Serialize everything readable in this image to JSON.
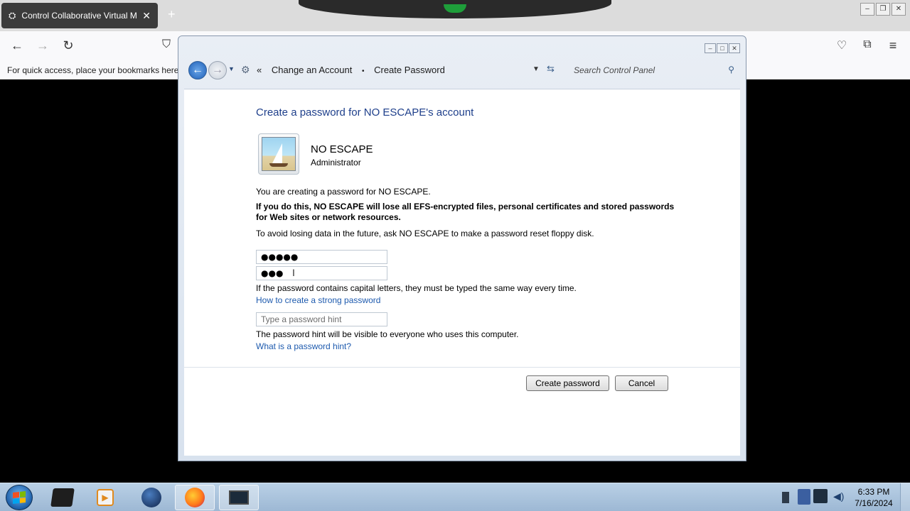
{
  "browser": {
    "tab_title": "Control Collaborative Virtual M",
    "tab_close": "✕",
    "new_tab": "+",
    "bookmarks_hint": "For quick access, place your bookmarks here on",
    "nav": {
      "back": "←",
      "forward": "→",
      "reload": "↻",
      "shield": "⛉",
      "pocket": "♡",
      "extensions": "⧉",
      "menu": "≡"
    },
    "window_controls": [
      "–",
      "❐",
      "✕"
    ]
  },
  "window": {
    "caption_buttons": [
      "–",
      "□",
      "✕"
    ],
    "breadcrumb": {
      "prefix": "«",
      "items": [
        "Change an Account",
        "Create Password"
      ],
      "separator": "•"
    },
    "search_placeholder": "Search Control Panel"
  },
  "content": {
    "heading": "Create a password for NO ESCAPE's account",
    "user": {
      "name": "NO ESCAPE",
      "type": "Administrator"
    },
    "info_text": "You are creating a password for NO ESCAPE.",
    "warning_text": "If you do this, NO ESCAPE will lose all EFS-encrypted files, personal certificates and stored passwords for Web sites or network resources.",
    "advice_text": "To avoid losing data in the future, ask NO ESCAPE to make a password reset floppy disk.",
    "password_value": "●●●●●",
    "confirm_value": "●●●",
    "caps_note": "If the password contains capital letters, they must be typed the same way every time.",
    "strong_link": "How to create a strong password",
    "hint_placeholder": "Type a password hint",
    "hint_note": "The password hint will be visible to everyone who uses this computer.",
    "hint_link": "What is a password hint?",
    "create_button": "Create password",
    "cancel_button": "Cancel"
  },
  "taskbar": {
    "apps": [
      "terminal",
      "media-player",
      "browser-globe",
      "firefox",
      "remote-desktop"
    ],
    "clock_time": "6:33 PM",
    "clock_date": "7/16/2024"
  },
  "colors": {
    "accent": "#1e3f8b",
    "link": "#1d5aae",
    "taskbar": "#a9c3dc"
  }
}
